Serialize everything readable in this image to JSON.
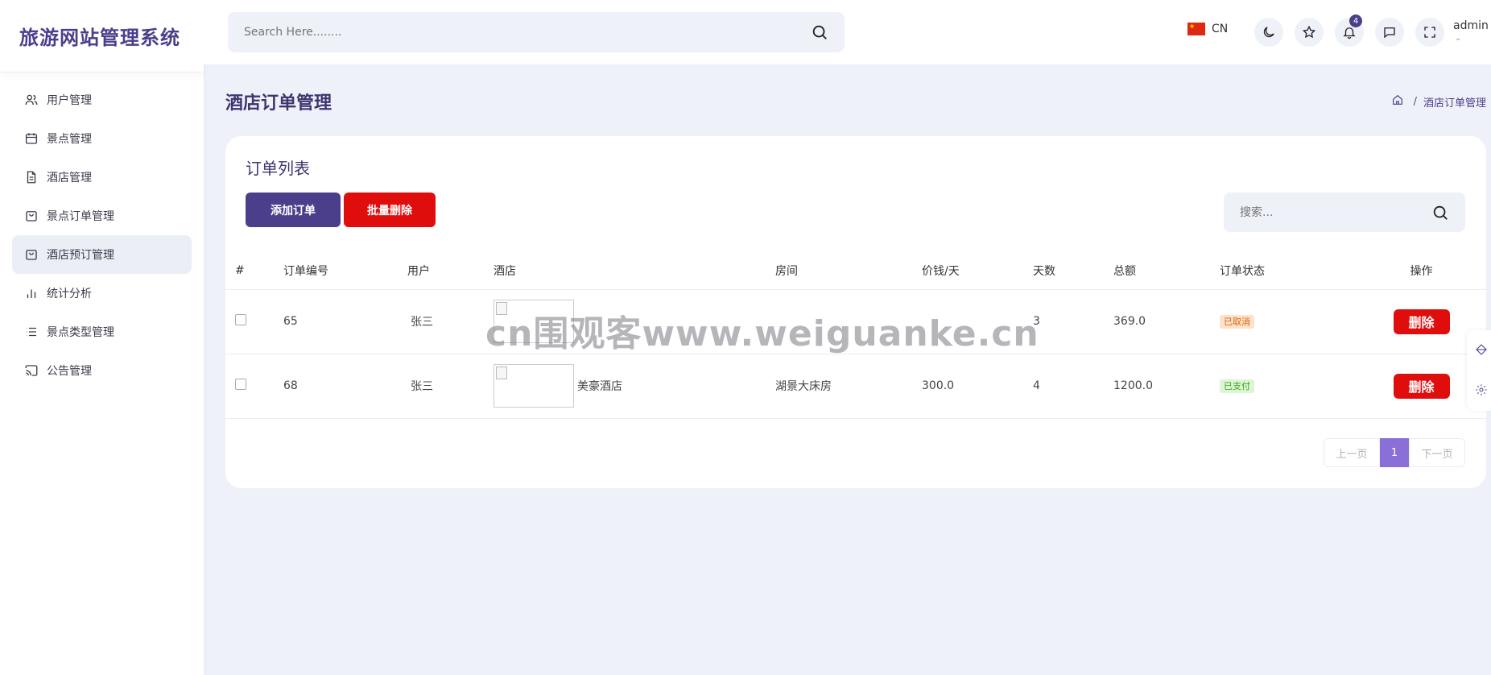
{
  "brand": {
    "title": "旅游网站管理系统"
  },
  "sidebar": {
    "items": [
      {
        "label": "用户管理",
        "icon": "users-icon"
      },
      {
        "label": "景点管理",
        "icon": "calendar-icon"
      },
      {
        "label": "酒店管理",
        "icon": "document-icon"
      },
      {
        "label": "景点订单管理",
        "icon": "shopping-bag-icon"
      },
      {
        "label": "酒店预订管理",
        "icon": "shopping-bag-icon",
        "active": true
      },
      {
        "label": "统计分析",
        "icon": "bar-chart-icon"
      },
      {
        "label": "景点类型管理",
        "icon": "list-icon"
      },
      {
        "label": "公告管理",
        "icon": "cast-icon"
      }
    ]
  },
  "header": {
    "search_placeholder": "Search Here........",
    "lang_label": "CN",
    "notification_count": "4",
    "user_name": "admin"
  },
  "page": {
    "title": "酒店订单管理",
    "breadcrumb_current": "酒店订单管理",
    "breadcrumb_sep": "/"
  },
  "card": {
    "title": "订单列表",
    "add_button": "添加订单",
    "batch_delete_button": "批量删除",
    "search_placeholder": "搜索..."
  },
  "table": {
    "headers": [
      "#",
      "订单编号",
      "用户",
      "酒店",
      "房间",
      "价钱/天",
      "天数",
      "总额",
      "订单状态",
      "操作"
    ],
    "rows": [
      {
        "id": "65",
        "user": "张三",
        "hotel": "",
        "room": "",
        "price": "",
        "days": "3",
        "total": "369.0",
        "status": "已取消",
        "action": "删除"
      },
      {
        "id": "68",
        "user": "张三",
        "hotel": "美豪酒店",
        "room": "湖景大床房",
        "price": "300.0",
        "days": "4",
        "total": "1200.0",
        "status": "已支付",
        "action": "删除"
      }
    ]
  },
  "pagination": {
    "prev": "上一页",
    "current": "1",
    "next": "下一页"
  },
  "watermark": "cn围观客www.weiguanke.cn",
  "colors": {
    "brand": "#4b3f8c",
    "danger": "#e00d0d",
    "page_active": "#8a6fd8"
  }
}
